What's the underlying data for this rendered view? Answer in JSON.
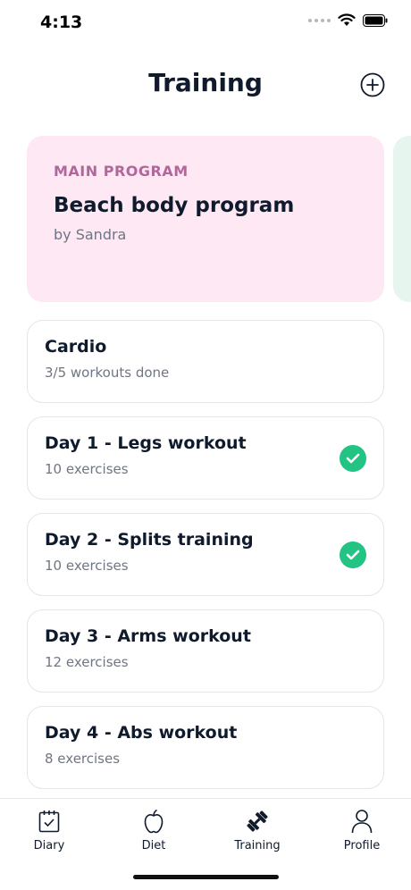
{
  "status": {
    "time": "4:13"
  },
  "header": {
    "title": "Training"
  },
  "program": {
    "eyebrow": "MAIN PROGRAM",
    "title": "Beach body program",
    "author": "by Sandra",
    "background": "#fde8f3"
  },
  "workouts": [
    {
      "title": "Cardio",
      "subtitle": "3/5 workouts done",
      "done": false
    },
    {
      "title": "Day 1 - Legs workout",
      "subtitle": "10 exercises",
      "done": true
    },
    {
      "title": "Day 2 - Splits training",
      "subtitle": "10 exercises",
      "done": true
    },
    {
      "title": "Day 3 - Arms workout",
      "subtitle": "12 exercises",
      "done": false
    },
    {
      "title": "Day 4 - Abs workout",
      "subtitle": "8 exercises",
      "done": false
    }
  ],
  "tabs": [
    {
      "label": "Diary",
      "icon": "calendar-icon"
    },
    {
      "label": "Diet",
      "icon": "apple-icon"
    },
    {
      "label": "Training",
      "icon": "dumbbell-icon",
      "active": true
    },
    {
      "label": "Profile",
      "icon": "person-icon"
    }
  ],
  "colors": {
    "accent_green": "#22c383",
    "text_dark": "#0f1b2d",
    "eyebrow_pink": "#b0679a"
  }
}
